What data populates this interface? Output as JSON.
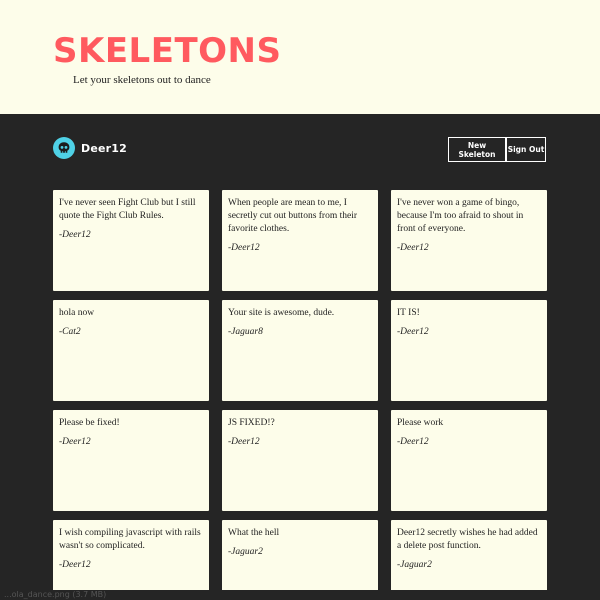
{
  "header": {
    "title": "SKELETONS",
    "tagline": "Let your skeletons out to dance"
  },
  "user": {
    "username": "Deer12",
    "avatar_icon": "skull-icon",
    "avatar_color": "#4fd1e6"
  },
  "actions": {
    "new_skeleton_label": "New Skeleton",
    "sign_out_label": "Sign Out"
  },
  "colors": {
    "brand": "#ff5a5f",
    "card_background": "#fdfdea",
    "page_background": "#252525"
  },
  "skeletons": [
    {
      "text": "I've never seen Fight Club but I still quote the Fight Club Rules.",
      "author": "-Deer12"
    },
    {
      "text": "When people are mean to me, I secretly cut out buttons from their favorite clothes.",
      "author": "-Deer12"
    },
    {
      "text": "I've never won a game of bingo, because I'm too afraid to shout in front of everyone.",
      "author": "-Deer12"
    },
    {
      "text": "hola now",
      "author": "-Cat2"
    },
    {
      "text": "Your site is awesome, dude.",
      "author": "-Jaguar8"
    },
    {
      "text": "IT IS!",
      "author": "-Deer12"
    },
    {
      "text": "Please be fixed!",
      "author": "-Deer12"
    },
    {
      "text": "JS FIXED!?",
      "author": "-Deer12"
    },
    {
      "text": "Please work",
      "author": "-Deer12"
    },
    {
      "text": "I wish compiling javascript with rails wasn't so complicated.",
      "author": "-Deer12"
    },
    {
      "text": "What the hell",
      "author": "-Jaguar2"
    },
    {
      "text": "Deer12 secretly wishes he had added a delete post function.",
      "author": "-Jaguar2"
    }
  ],
  "status_bar": {
    "text": "...ola_dance.png (3.7 MB)"
  }
}
